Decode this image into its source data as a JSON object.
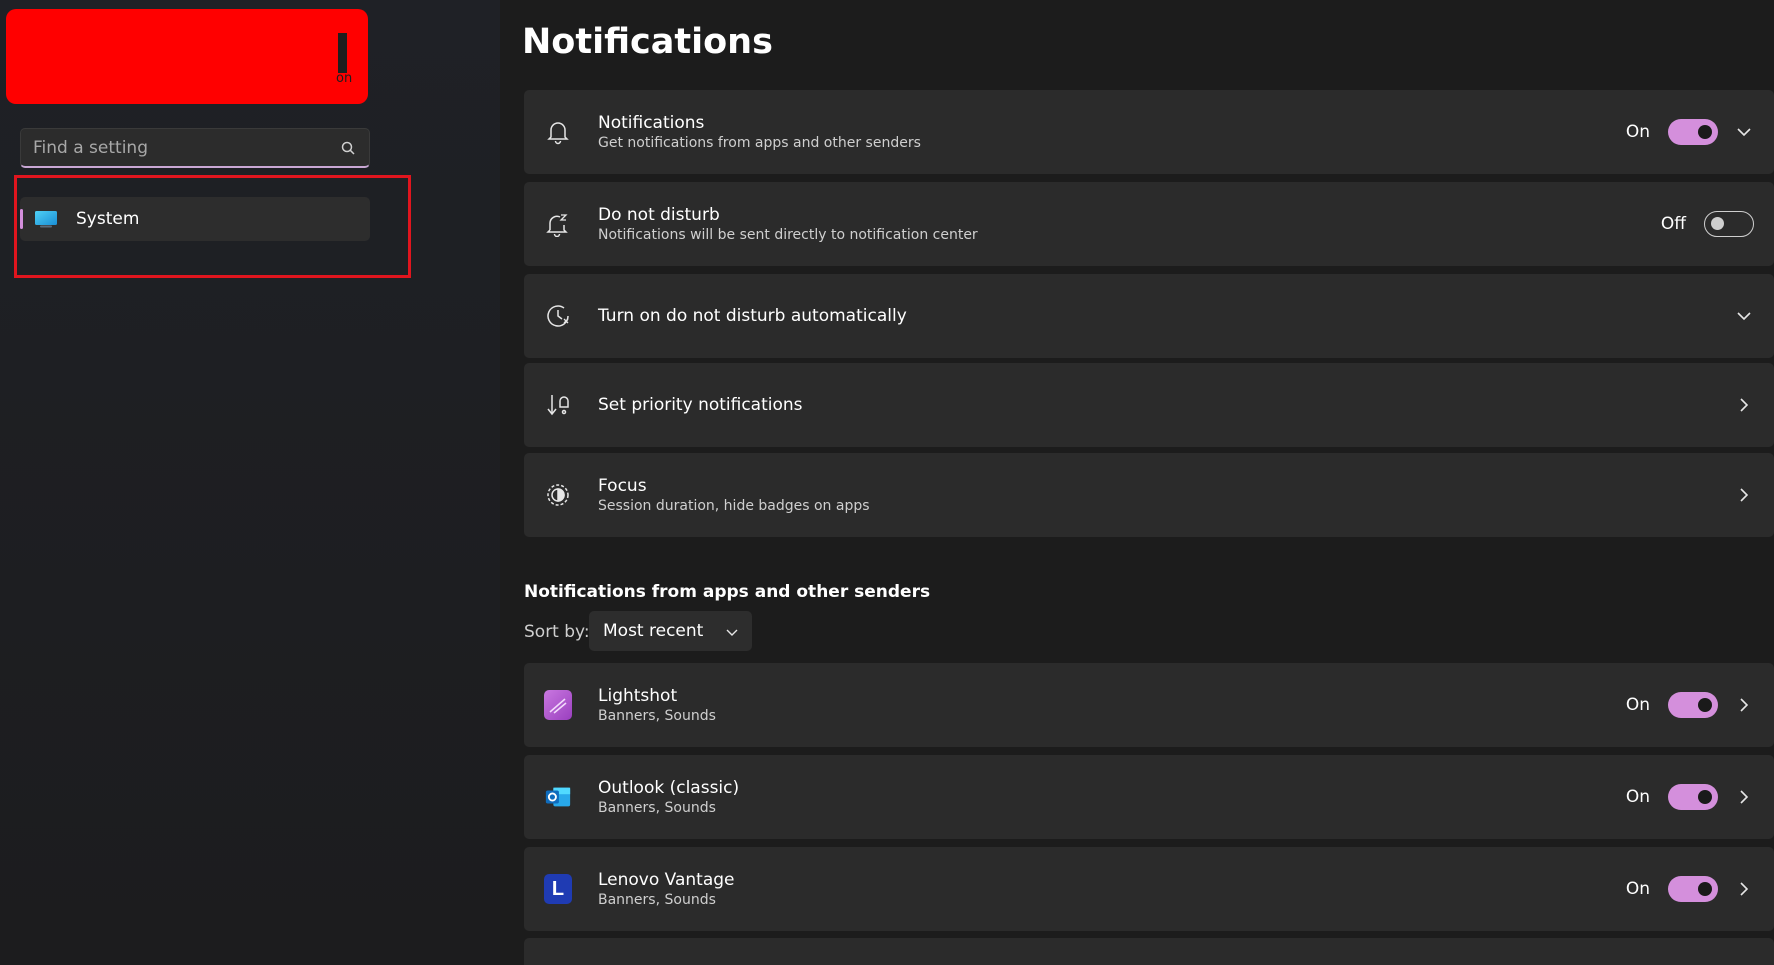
{
  "sidebar": {
    "redacted_fragment": "on",
    "search": {
      "placeholder": "Find a setting",
      "value": ""
    },
    "items": [
      {
        "label": "System",
        "icon": "system-monitor-icon",
        "selected": true
      }
    ]
  },
  "main": {
    "title": "Notifications",
    "cards": [
      {
        "title": "Notifications",
        "subtitle": "Get notifications from apps and other senders",
        "icon": "bell-icon",
        "state": "On",
        "toggle": true,
        "control": "chevron-down"
      },
      {
        "title": "Do not disturb",
        "subtitle": "Notifications will be sent directly to notification center",
        "icon": "bell-snooze-icon",
        "state": "Off",
        "toggle": false,
        "control": "none"
      },
      {
        "title": "Turn on do not disturb automatically",
        "icon": "clock-icon",
        "control": "chevron-down"
      },
      {
        "title": "Set priority notifications",
        "icon": "priority-icon",
        "control": "chevron-right"
      },
      {
        "title": "Focus",
        "subtitle": "Session duration, hide badges on apps",
        "icon": "focus-icon",
        "control": "chevron-right"
      }
    ],
    "apps_section": {
      "title": "Notifications from apps and other senders",
      "sort_label": "Sort by:",
      "sort_value": "Most recent",
      "apps": [
        {
          "name": "Lightshot",
          "subtitle": "Banners, Sounds",
          "state": "On",
          "icon": "lightshot-icon",
          "color": "#b052c9"
        },
        {
          "name": "Outlook (classic)",
          "subtitle": "Banners, Sounds",
          "state": "On",
          "icon": "outlook-icon",
          "color": "#0f6cbd"
        },
        {
          "name": "Lenovo Vantage",
          "subtitle": "Banners, Sounds",
          "state": "On",
          "icon": "lenovo-vantage-icon",
          "icon_letter": "L",
          "color": "#1f3bb3"
        }
      ]
    }
  },
  "colors": {
    "accent": "#d48fdc",
    "card": "#2b2b2b",
    "highlight": "#e0151e",
    "redaction": "#ff0000"
  }
}
